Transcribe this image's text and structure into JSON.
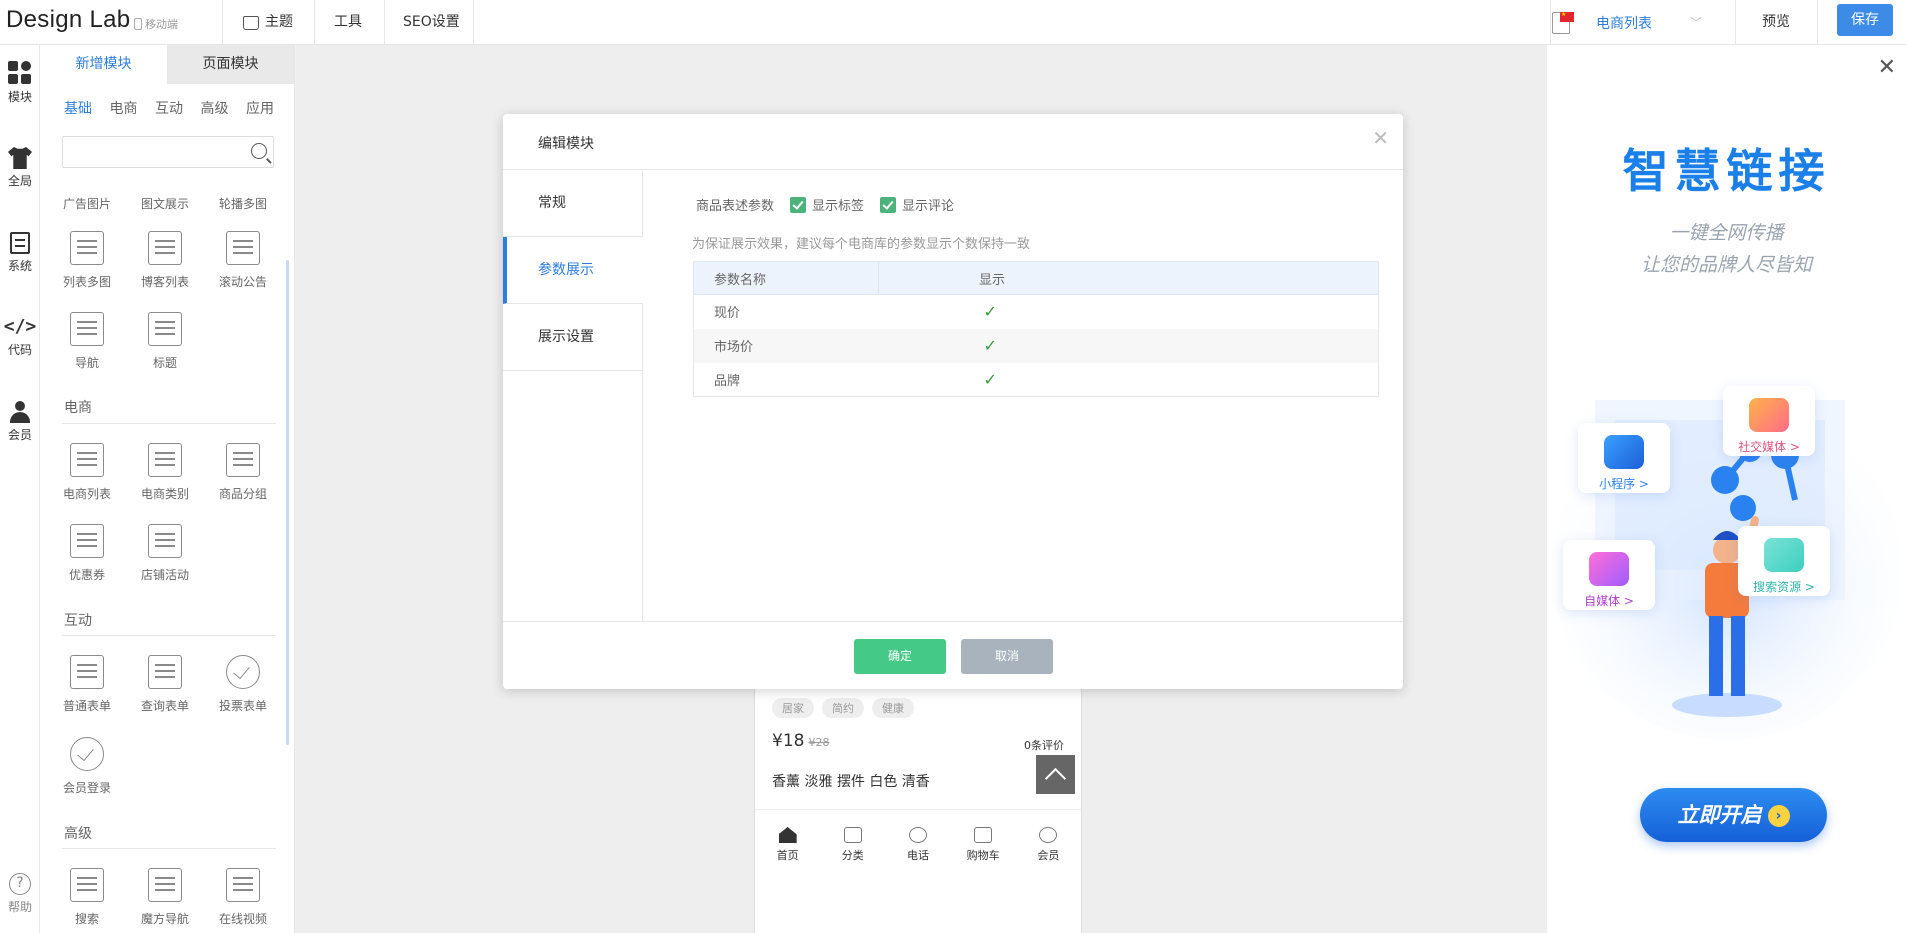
{
  "app": {
    "logo": "Design Lab",
    "mobile_tag": "移动端"
  },
  "topnav": {
    "theme": "主题",
    "tools": "工具",
    "seo": "SEO设置"
  },
  "lang": {
    "label": "电商列表",
    "flag": "cn-flag-icon"
  },
  "header_actions": {
    "preview": "预览",
    "save": "保存"
  },
  "rail": {
    "items": [
      {
        "label": "模块",
        "icon": "modules-icon"
      },
      {
        "label": "全局",
        "icon": "shirt-icon"
      },
      {
        "label": "系统",
        "icon": "document-icon"
      },
      {
        "label": "代码",
        "icon": "code-icon"
      },
      {
        "label": "会员",
        "icon": "user-icon"
      }
    ],
    "help": "帮助"
  },
  "panel": {
    "tabs": [
      "新增模块",
      "页面模块"
    ],
    "categories": [
      "基础",
      "电商",
      "互动",
      "高级",
      "应用"
    ],
    "search_placeholder": "",
    "top_row": [
      "广告图片",
      "图文展示",
      "轮播多图"
    ],
    "basic": [
      "列表多图",
      "博客列表",
      "滚动公告",
      "导航",
      "标题"
    ],
    "sections": {
      "ecommerce": "电商",
      "interactive": "互动",
      "advanced": "高级"
    },
    "ecommerce_items": [
      "电商列表",
      "电商类别",
      "商品分组",
      "优惠券",
      "店铺活动"
    ],
    "interactive_items": [
      "普通表单",
      "查询表单",
      "投票表单",
      "会员登录"
    ],
    "advanced_items": [
      "搜索",
      "魔方导航",
      "在线视频"
    ]
  },
  "phone_preview": {
    "tags": [
      "居家",
      "简约",
      "健康"
    ],
    "price": "¥18",
    "old_price": "¥28",
    "reviews": "0条评价",
    "product_name": "香薰 淡雅 摆件 白色 清香",
    "tabbar": [
      "首页",
      "分类",
      "电话",
      "购物车",
      "会员"
    ]
  },
  "modal": {
    "title": "编辑模块",
    "tabs": [
      "常规",
      "参数展示",
      "展示设置"
    ],
    "param_label": "商品表述参数",
    "show_tags": "显示标签",
    "show_reviews": "显示评论",
    "hint": "为保证展示效果，建议每个电商库的参数显示个数保持一致",
    "table": {
      "headers": [
        "参数名称",
        "显示"
      ],
      "rows": [
        {
          "name": "现价",
          "shown": "✓"
        },
        {
          "name": "市场价",
          "shown": "✓"
        },
        {
          "name": "品牌",
          "shown": "✓"
        }
      ]
    },
    "ok": "确定",
    "cancel": "取消"
  },
  "promo": {
    "title": "智慧链接",
    "sub1": "一键全网传播",
    "sub2": "让您的品牌人尽皆知",
    "cards": [
      "小程序 >",
      "社交媒体 >",
      "自媒体 >",
      "搜索资源 >"
    ],
    "cta": "立即开启",
    "colors": {
      "brand": "#1a7fe8",
      "accent": "#2e7ddc",
      "confirm": "#45c987"
    }
  }
}
